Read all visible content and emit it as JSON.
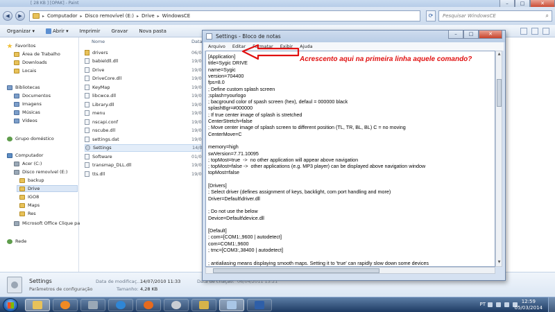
{
  "explorer": {
    "title_fragment": "[ 28 KB ] [OPAK] - Paint",
    "breadcrumb": [
      "Computador",
      "Disco removível (E:)",
      "Drive",
      "WindowsCE"
    ],
    "search_placeholder": "Pesquisar WindowsCE",
    "toolbar": [
      "Organizar ▾",
      "Abrir ▾",
      "Imprimir",
      "Gravar",
      "Nova pasta"
    ],
    "nav": {
      "favoritos": "Favoritos",
      "fav_items": [
        "Área de Trabalho",
        "Downloads",
        "Locais"
      ],
      "bibliotecas": "Bibliotecas",
      "lib_items": [
        "Documentos",
        "Imagens",
        "Músicas",
        "Vídeos"
      ],
      "grupo": "Grupo doméstico",
      "computador": "Computador",
      "drives": [
        "Acer (C:)",
        "Disco removível (E:)"
      ],
      "subfolders": [
        "backup",
        "Drive",
        "IGO8",
        "Maps",
        "Res"
      ],
      "office": "Microsoft Office Clique pa",
      "rede": "Rede"
    },
    "columns": {
      "name": "Nome",
      "date": "Data"
    },
    "files": [
      {
        "name": "drivers",
        "date": "06/04/",
        "kind": "folder"
      },
      {
        "name": "babieldll.dll",
        "date": "19/02/",
        "kind": "file"
      },
      {
        "name": "Drive",
        "date": "19/02/",
        "kind": "file"
      },
      {
        "name": "DriveCore.dll",
        "date": "19/02/",
        "kind": "file"
      },
      {
        "name": "KeyMap",
        "date": "19/02/",
        "kind": "file"
      },
      {
        "name": "libcwce.dll",
        "date": "19/02/",
        "kind": "file"
      },
      {
        "name": "Library.dll",
        "date": "19/02/",
        "kind": "file"
      },
      {
        "name": "menu",
        "date": "19/02/",
        "kind": "file"
      },
      {
        "name": "nscapi.conf",
        "date": "19/02/",
        "kind": "file"
      },
      {
        "name": "nscube.dll",
        "date": "19/02/",
        "kind": "file"
      },
      {
        "name": "settings.dat",
        "date": "19/02/",
        "kind": "file"
      },
      {
        "name": "Settings",
        "date": "14/07/",
        "kind": "gear"
      },
      {
        "name": "Software",
        "date": "01/02/",
        "kind": "file"
      },
      {
        "name": "transmap_DLL.dll",
        "date": "19/02/",
        "kind": "file"
      },
      {
        "name": "tts.dll",
        "date": "19/02/",
        "kind": "file"
      }
    ],
    "details": {
      "name": "Settings",
      "type": "Parâmetros de configuração",
      "mod_label": "Data de modificaç...",
      "mod_value": "14/07/2010 11:33",
      "size_label": "Tamanho:",
      "size_value": "4,28 KB",
      "created_label": "Data de criação:",
      "created_value": "06/04/2011 13:21"
    }
  },
  "notepad": {
    "title": "Settings - Bloco de notas",
    "menu": [
      "Arquivo",
      "Editar",
      "Formatar",
      "Exibir",
      "Ajuda"
    ],
    "lines": [
      "[Application]",
      "title=Sygic DRIVE",
      "name=Sygic",
      "version=704400",
      "fps=8.0",
      "; Define custom splash screen",
      ";splash=yourlogo",
      "; bacground color of spash screen (hex), defaul = 000000 black",
      "splashBgr=#000000",
      "; If true center image of splash is stretched",
      "CenterStretch=false",
      "; Move center image of splash screen to different position (TL, TR, BL, BL) C = no moving",
      "CenterMove=C",
      "",
      "memory=high",
      "swVersion=7.71.10095",
      "; topMost=true  ->  no other application will appear above navigation",
      "; topMost=false ->  other applications (e.g. MP3 player) can be displayed above navigation window",
      "topMost=false",
      "",
      "[Drivers]",
      "; Select driver (defines assignment of keys, backlight, com port handling and more)",
      "Driver=Default\\driver.dll",
      "",
      "; Do not use the below",
      "Device=Default\\device.dll",
      "",
      "[Default]",
      "; com=[COM1:,9600 | autodetect]",
      "com=COM1:,9600",
      "; tmc=[COM3:,38400 | autodetect]",
      "",
      "; antialiasing means displaying smooth maps. Setting it to 'true' can rapidly slow down some devices"
    ]
  },
  "annotation": "Acrescento aqui na primeira linha aquele comando?",
  "taskbar": {
    "lang": "PT",
    "time": "12:59",
    "date": "05/03/2014"
  },
  "colors": {
    "annotation": "#e01010",
    "arrow": "#e01010",
    "taskbar": "#1d3a62"
  }
}
